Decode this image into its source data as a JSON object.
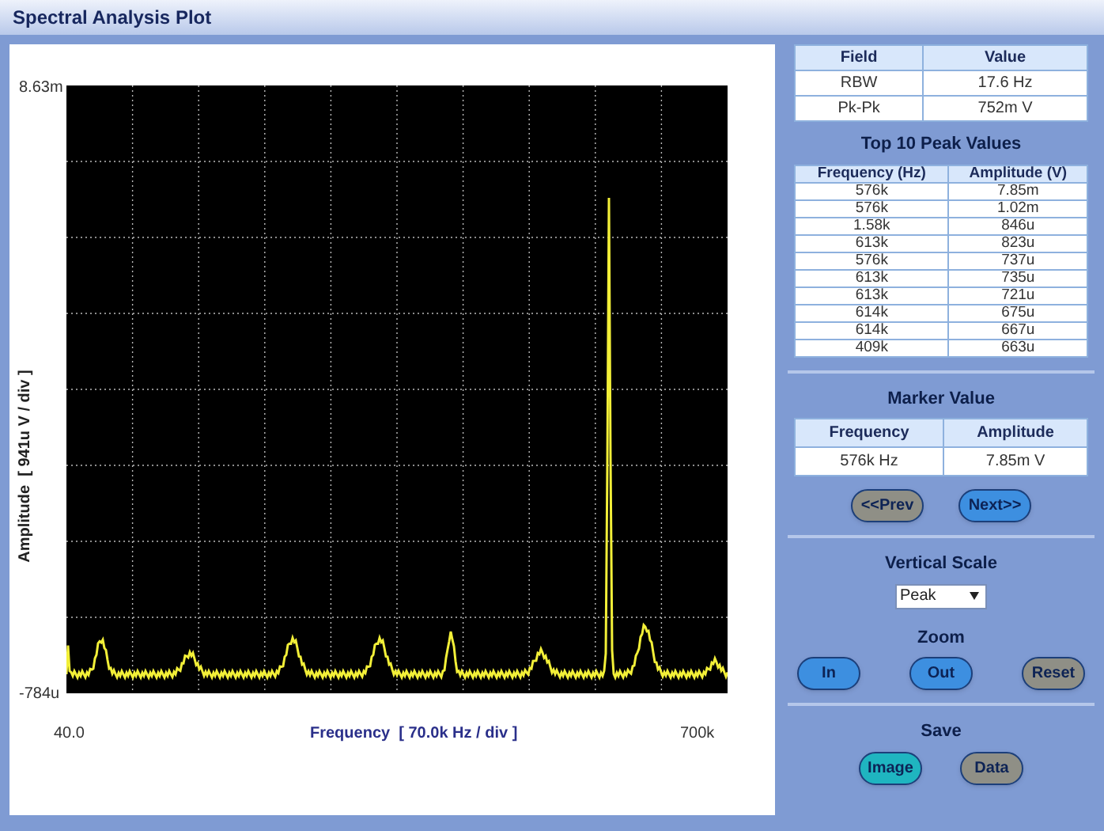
{
  "window": {
    "title": "Spectral Analysis Plot"
  },
  "plot": {
    "y_max": "8.63m",
    "y_min": "-784u",
    "x_min": "40.0",
    "x_max": "700k",
    "xlabel": "Frequency  [ 70.0k Hz / div ]",
    "ylabel": "Amplitude  [ 941u V / div ]"
  },
  "field_table": {
    "columns": [
      "Field",
      "Value"
    ],
    "rows": [
      [
        "RBW",
        "17.6 Hz"
      ],
      [
        "Pk-Pk",
        "752m V"
      ]
    ]
  },
  "peaks": {
    "title": "Top 10 Peak Values",
    "columns": [
      "Frequency (Hz)",
      "Amplitude (V)"
    ],
    "rows": [
      [
        "576k",
        "7.85m"
      ],
      [
        "576k",
        "1.02m"
      ],
      [
        "1.58k",
        "846u"
      ],
      [
        "613k",
        "823u"
      ],
      [
        "576k",
        "737u"
      ],
      [
        "613k",
        "735u"
      ],
      [
        "613k",
        "721u"
      ],
      [
        "614k",
        "675u"
      ],
      [
        "614k",
        "667u"
      ],
      [
        "409k",
        "663u"
      ]
    ]
  },
  "marker": {
    "title": "Marker Value",
    "columns": [
      "Frequency",
      "Amplitude"
    ],
    "row": [
      "576k Hz",
      "7.85m V"
    ],
    "buttons": [
      {
        "label": "<<Prev",
        "color": "#8f8f86"
      },
      {
        "label": "Next>>",
        "color": "#3d8fe0"
      }
    ]
  },
  "vertical_scale": {
    "title": "Vertical Scale",
    "value": "Peak"
  },
  "zoom": {
    "title": "Zoom",
    "buttons": [
      {
        "label": "In",
        "color": "#3d8fe0"
      },
      {
        "label": "Out",
        "color": "#3d8fe0"
      },
      {
        "label": "Reset",
        "color": "#8f8f86"
      }
    ]
  },
  "save": {
    "title": "Save",
    "buttons": [
      {
        "label": "Image",
        "color": "#1fb5c0"
      },
      {
        "label": "Data",
        "color": "#8f8f86"
      }
    ]
  }
}
